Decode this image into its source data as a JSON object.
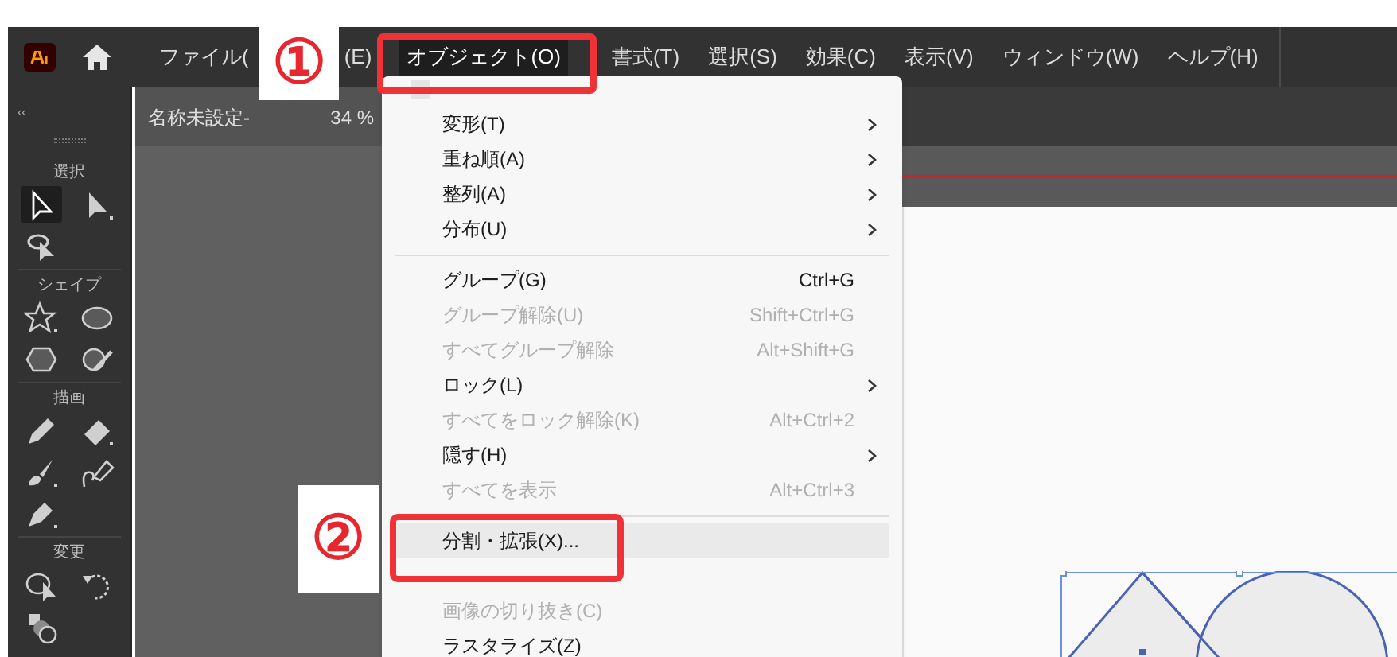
{
  "menubar": {
    "items": [
      {
        "label": "ファイル(",
        "selected": false
      },
      {
        "label": "(E)",
        "selected": false
      },
      {
        "label": "オブジェクト(O)",
        "selected": true
      },
      {
        "label": "書式(T)",
        "selected": false
      },
      {
        "label": "選択(S)",
        "selected": false
      },
      {
        "label": "効果(C)",
        "selected": false
      },
      {
        "label": "表示(V)",
        "selected": false
      },
      {
        "label": "ウィンドウ(W)",
        "selected": false
      },
      {
        "label": "ヘルプ(H)",
        "selected": false
      }
    ]
  },
  "document_tab": {
    "title": "名称未設定-",
    "zoom": "34 %"
  },
  "toolbar": {
    "collapse": "‹‹",
    "sections": [
      {
        "label": "選択",
        "tools": [
          {
            "kind": "selection",
            "selected": true
          },
          {
            "kind": "direct-selection",
            "selected": false
          },
          {
            "kind": "lasso",
            "selected": false
          }
        ]
      },
      {
        "label": "シェイプ",
        "tools": [
          {
            "kind": "star",
            "selected": false
          },
          {
            "kind": "ellipse",
            "selected": false
          },
          {
            "kind": "hexagon",
            "selected": false
          },
          {
            "kind": "shaper",
            "selected": false
          }
        ]
      },
      {
        "label": "描画",
        "tools": [
          {
            "kind": "pencil",
            "selected": false
          },
          {
            "kind": "eraser",
            "selected": false
          },
          {
            "kind": "brush",
            "selected": false
          },
          {
            "kind": "curvature",
            "selected": false
          },
          {
            "kind": "pen",
            "selected": false
          }
        ]
      },
      {
        "label": "変更",
        "tools": [
          {
            "kind": "warp",
            "selected": false
          },
          {
            "kind": "rotate",
            "selected": false
          },
          {
            "kind": "shape-builder",
            "selected": false
          }
        ]
      }
    ]
  },
  "menu": {
    "items": [
      {
        "kind": "item",
        "label": "変形(T)",
        "submenu": true,
        "disabled": false,
        "hovered": false
      },
      {
        "kind": "item",
        "label": "重ね順(A)",
        "submenu": true,
        "disabled": false,
        "hovered": false
      },
      {
        "kind": "item",
        "label": "整列(A)",
        "submenu": true,
        "disabled": false,
        "hovered": false
      },
      {
        "kind": "item",
        "label": "分布(U)",
        "submenu": true,
        "disabled": false,
        "hovered": false
      },
      {
        "kind": "separator"
      },
      {
        "kind": "item",
        "label": "グループ(G)",
        "shortcut": "Ctrl+G",
        "submenu": false,
        "disabled": false,
        "hovered": false
      },
      {
        "kind": "item",
        "label": "グループ解除(U)",
        "shortcut": "Shift+Ctrl+G",
        "submenu": false,
        "disabled": true,
        "hovered": false
      },
      {
        "kind": "item",
        "label": "すべてグループ解除",
        "shortcut": "Alt+Shift+G",
        "submenu": false,
        "disabled": true,
        "hovered": false
      },
      {
        "kind": "item",
        "label": "ロック(L)",
        "submenu": true,
        "disabled": false,
        "hovered": false
      },
      {
        "kind": "item",
        "label": "すべてをロック解除(K)",
        "shortcut": "Alt+Ctrl+2",
        "submenu": false,
        "disabled": true,
        "hovered": false
      },
      {
        "kind": "item",
        "label": "隠す(H)",
        "submenu": true,
        "disabled": false,
        "hovered": false
      },
      {
        "kind": "item",
        "label": "すべてを表示",
        "shortcut": "Alt+Ctrl+3",
        "submenu": false,
        "disabled": true,
        "hovered": false
      },
      {
        "kind": "separator"
      },
      {
        "kind": "item",
        "label": "分割・拡張(X)...",
        "submenu": false,
        "disabled": false,
        "hovered": true
      },
      {
        "kind": "obscured"
      },
      {
        "kind": "item",
        "label": "画像の切り抜き(C)",
        "submenu": false,
        "disabled": true,
        "hovered": false
      },
      {
        "kind": "item",
        "label": "ラスタライズ(Z)",
        "submenu": false,
        "disabled": false,
        "hovered": false
      }
    ]
  },
  "callouts": [
    {
      "label": "①"
    },
    {
      "label": "②"
    }
  ]
}
